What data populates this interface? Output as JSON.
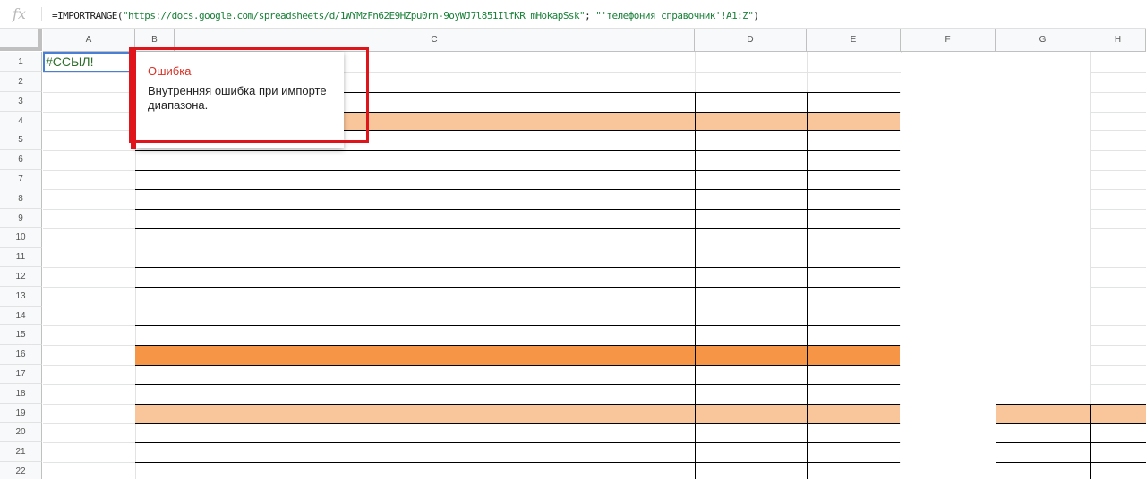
{
  "formula_bar": {
    "icon": "fx",
    "formula_fn": "=IMPORTRANGE(",
    "formula_arg1": "\"https://docs.google.com/spreadsheets/d/1WYMzFn62E9HZpu0rn-9oyWJ7l851IlfKR_mHokapSsk\"",
    "formula_sep": "; ",
    "formula_arg2": "\"'телефония справочник'!A1:Z\"",
    "formula_end": ")"
  },
  "columns": [
    "A",
    "B",
    "C",
    "D",
    "E",
    "F",
    "G",
    "H"
  ],
  "rows": [
    "1",
    "2",
    "3",
    "4",
    "5",
    "6",
    "7",
    "8",
    "9",
    "10",
    "11",
    "12",
    "13",
    "14",
    "15",
    "16",
    "17",
    "18",
    "19",
    "20",
    "21",
    "22"
  ],
  "cells": {
    "A1": "#ССЫЛ!"
  },
  "error_tooltip": {
    "title": "Ошибка",
    "message": "Внутренняя ошибка при импорте диапазона."
  },
  "colors": {
    "light_orange": "#f9c59b",
    "orange": "#f69545",
    "error_red": "#d93025",
    "selection_blue": "#4a7fd6"
  }
}
